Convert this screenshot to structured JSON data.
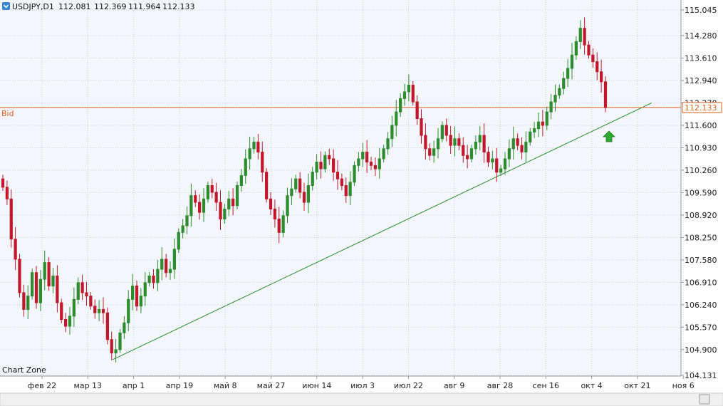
{
  "symbol_header": {
    "symbol": "USDJPY,D1",
    "open": "112.081",
    "high": "112.369",
    "low": "111.964",
    "close": "112.133"
  },
  "bid_line": {
    "label": "Bid",
    "value": 112.133,
    "value_text": "112.133",
    "color": "#e0601c"
  },
  "watermark": "Chart Zone",
  "colors": {
    "bull": "#2e8b2e",
    "bear": "#c0192b",
    "trendline": "#2e8b2e",
    "arrow": "#2fa82f",
    "background": "#f3f7fc"
  },
  "arrow_icon": "up-arrow-icon",
  "chart_data": {
    "type": "candlestick",
    "ylim": [
      104.131,
      115.045
    ],
    "yticks": [
      "115.045",
      "114.280",
      "113.610",
      "112.940",
      "112.270",
      "111.600",
      "110.930",
      "110.260",
      "109.590",
      "108.920",
      "108.250",
      "107.580",
      "106.910",
      "106.240",
      "105.570",
      "104.900",
      "104.131"
    ],
    "xtick_labels": [
      "фев 22",
      "мар 13",
      "апр 1",
      "апр 19",
      "май 8",
      "май 27",
      "июн 14",
      "июл 3",
      "июл 22",
      "авг 9",
      "авг 28",
      "сен 16",
      "окт 4",
      "окт 21",
      "ноя 6"
    ],
    "trendline": {
      "start": {
        "bar": 0,
        "price": 104.6
      },
      "end": {
        "bar": 13,
        "price": 112.27
      }
    },
    "close_series": [
      109.75,
      109.4,
      108.2,
      107.6,
      106.6,
      106.1,
      106.5,
      107.2,
      106.3,
      107.0,
      107.5,
      106.8,
      107.1,
      106.3,
      105.8,
      105.6,
      105.9,
      106.4,
      106.9,
      106.6,
      106.5,
      106.2,
      106.0,
      106.1,
      106.0,
      105.2,
      104.8,
      104.9,
      105.4,
      105.7,
      106.4,
      106.8,
      106.2,
      106.5,
      106.9,
      107.1,
      106.9,
      107.3,
      107.6,
      107.2,
      107.3,
      107.9,
      108.4,
      108.6,
      108.9,
      109.5,
      109.3,
      109.0,
      109.4,
      109.8,
      109.6,
      109.3,
      108.8,
      109.1,
      109.4,
      109.2,
      109.8,
      110.1,
      110.6,
      110.9,
      111.1,
      110.8,
      110.2,
      109.4,
      109.1,
      108.8,
      108.4,
      108.9,
      109.5,
      109.7,
      110.0,
      109.6,
      109.3,
      109.8,
      110.2,
      110.5,
      110.3,
      110.7,
      110.6,
      110.2,
      110.0,
      109.8,
      109.5,
      109.9,
      110.4,
      110.6,
      110.8,
      110.5,
      110.4,
      110.3,
      110.6,
      110.9,
      111.2,
      111.6,
      112.0,
      112.4,
      112.6,
      112.8,
      112.3,
      111.8,
      111.3,
      110.9,
      110.7,
      110.9,
      111.2,
      111.6,
      111.3,
      111.0,
      111.2,
      111.0,
      110.7,
      110.6,
      110.9,
      111.1,
      111.3,
      110.8,
      110.5,
      110.6,
      110.2,
      110.3,
      110.6,
      110.9,
      111.2,
      111.0,
      110.8,
      111.1,
      111.4,
      111.5,
      111.7,
      111.6,
      112.0,
      112.3,
      112.5,
      112.7,
      113.0,
      113.3,
      113.7,
      114.1,
      114.5,
      114.0,
      113.7,
      113.5,
      113.2,
      112.9,
      112.133
    ]
  }
}
